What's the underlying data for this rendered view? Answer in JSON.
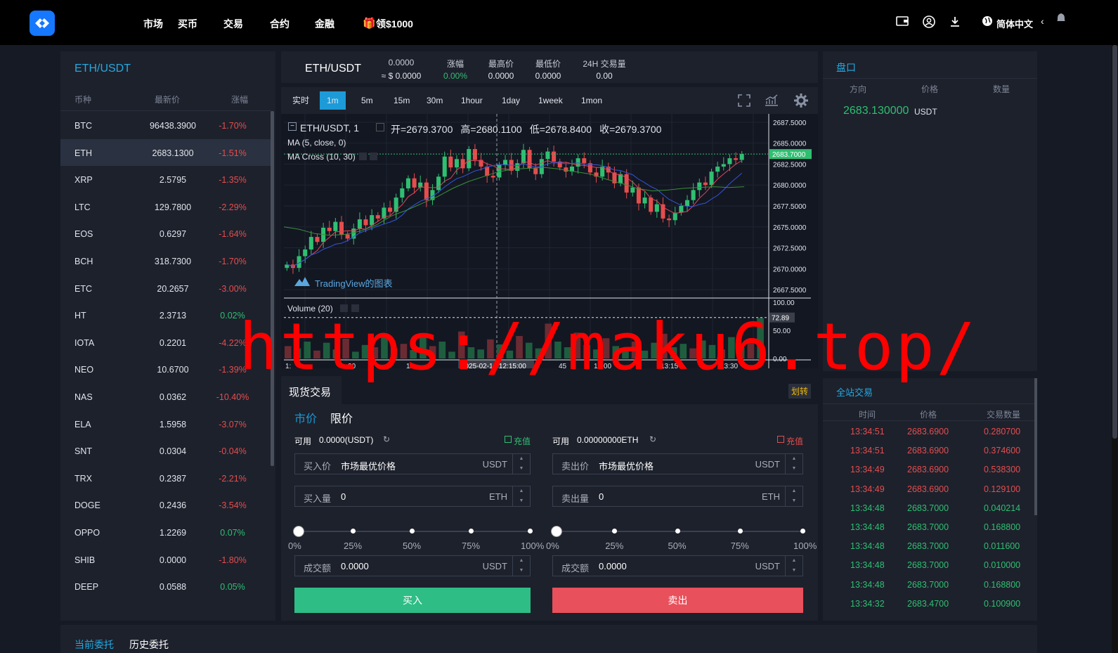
{
  "nav": {
    "items": [
      "市场",
      "买币",
      "交易",
      "合约",
      "金融"
    ],
    "promo": "领$1000",
    "lang": "简体中文"
  },
  "market": {
    "title": "ETH/USDT",
    "headers": [
      "币种",
      "最新价",
      "涨幅"
    ],
    "rows": [
      {
        "sym": "BTC",
        "price": "96438.3900",
        "chg": "-1.70%",
        "dir": "down"
      },
      {
        "sym": "ETH",
        "price": "2683.1300",
        "chg": "-1.51%",
        "dir": "down"
      },
      {
        "sym": "XRP",
        "price": "2.5795",
        "chg": "-1.35%",
        "dir": "down"
      },
      {
        "sym": "LTC",
        "price": "129.7800",
        "chg": "-2.29%",
        "dir": "down"
      },
      {
        "sym": "EOS",
        "price": "0.6297",
        "chg": "-1.64%",
        "dir": "down"
      },
      {
        "sym": "BCH",
        "price": "318.7300",
        "chg": "-1.70%",
        "dir": "down"
      },
      {
        "sym": "ETC",
        "price": "20.2657",
        "chg": "-3.00%",
        "dir": "down"
      },
      {
        "sym": "HT",
        "price": "2.3713",
        "chg": "0.02%",
        "dir": "up"
      },
      {
        "sym": "IOTA",
        "price": "0.2201",
        "chg": "-4.22%",
        "dir": "down"
      },
      {
        "sym": "NEO",
        "price": "10.6700",
        "chg": "-1.39%",
        "dir": "down"
      },
      {
        "sym": "NAS",
        "price": "0.0362",
        "chg": "-10.40%",
        "dir": "down"
      },
      {
        "sym": "ELA",
        "price": "1.5958",
        "chg": "-3.07%",
        "dir": "down"
      },
      {
        "sym": "SNT",
        "price": "0.0304",
        "chg": "-0.04%",
        "dir": "down"
      },
      {
        "sym": "TRX",
        "price": "0.2387",
        "chg": "-2.21%",
        "dir": "down"
      },
      {
        "sym": "DOGE",
        "price": "0.2436",
        "chg": "-3.54%",
        "dir": "down"
      },
      {
        "sym": "OPPO",
        "price": "1.2269",
        "chg": "0.07%",
        "dir": "up"
      },
      {
        "sym": "SHIB",
        "price": "0.0000",
        "chg": "-1.80%",
        "dir": "down"
      },
      {
        "sym": "DEEP",
        "price": "0.0588",
        "chg": "0.05%",
        "dir": "up"
      }
    ]
  },
  "ticker": {
    "symbol": "ETH/USDT",
    "price": "0.0000",
    "price_usd": "≈ $ 0.0000",
    "labels": [
      "涨幅",
      "最高价",
      "最低价",
      "24H 交易量"
    ],
    "values": [
      "0.00%",
      "0.0000",
      "0.0000",
      "0.00"
    ]
  },
  "chart": {
    "timeframes": [
      "实时",
      "1m",
      "5m",
      "15m",
      "30m",
      "1hour",
      "1day",
      "1week",
      "1mon"
    ],
    "active_tf": "1m",
    "symbol_line": "ETH/USDT, 1",
    "ohlc": [
      {
        "k": "开=",
        "v": "2679.3700"
      },
      {
        "k": "高=",
        "v": "2680.1100"
      },
      {
        "k": "低=",
        "v": "2678.8400"
      },
      {
        "k": "收=",
        "v": "2679.3700"
      }
    ],
    "ma_label": "MA (5, close, 0)",
    "macross_label": "MA Cross (10, 30)",
    "tv_label": "TradingView的图表",
    "volume_label": "Volume (20)",
    "price_ticks": [
      "2687.5000",
      "2685.0000",
      "2682.5000",
      "2680.0000",
      "2677.5000",
      "2675.0000",
      "2672.5000",
      "2670.0000",
      "2667.5000"
    ],
    "last_price": "2683.7000",
    "vol_ticks": [
      "100.00",
      "50.00",
      "0.00"
    ],
    "vol_last": "72.89",
    "time_ticks": [
      "1:",
      "00",
      "12:",
      "45",
      "13:00",
      "13:15",
      "13:30"
    ],
    "crosshair_time": "2025-02-12 12:15:00"
  },
  "chart_data": {
    "type": "candlestick",
    "title": "ETH/USDT, 1",
    "ylim": [
      2666.5,
      2688.5
    ],
    "closes": [
      2670.5,
      2670.1,
      2671.5,
      2672.3,
      2673.8,
      2673.2,
      2674.9,
      2674.5,
      2675.6,
      2674.1,
      2673.6,
      2674.8,
      2675.9,
      2675.2,
      2676.4,
      2676.0,
      2677.3,
      2676.8,
      2678.5,
      2679.6,
      2680.8,
      2679.7,
      2680.3,
      2678.2,
      2679.4,
      2681.0,
      2683.4,
      2682.1,
      2683.1,
      2682.0,
      2684.3,
      2683.0,
      2682.2,
      2681.1,
      2680.9,
      2682.4,
      2683.0,
      2681.7,
      2682.6,
      2684.2,
      2682.0,
      2681.3,
      2683.1,
      2684.0,
      2682.8,
      2682.1,
      2681.6,
      2682.2,
      2683.2,
      2682.6,
      2681.5,
      2681.0,
      2682.2,
      2681.5,
      2680.2,
      2681.3,
      2679.1,
      2679.7,
      2677.8,
      2678.5,
      2676.8,
      2677.7,
      2676.0,
      2675.8,
      2676.7,
      2677.5,
      2678.2,
      2679.4,
      2680.3,
      2680.0,
      2681.6,
      2682.2,
      2682.5,
      2683.2,
      2683.0,
      2683.7
    ],
    "ma_cross_long": [
      2675.0,
      2674.7,
      2674.2,
      2674.0,
      2674.1,
      2674.5,
      2675.2,
      2676.3,
      2677.0,
      2677.8,
      2678.6,
      2679.6,
      2680.4,
      2681.0,
      2681.6,
      2681.9,
      2682.0,
      2682.1,
      2681.9,
      2681.6,
      2681.3,
      2680.7,
      2680.2,
      2679.6,
      2679.3,
      2679.4,
      2679.6,
      2679.7,
      2679.8,
      2679.7,
      2679.8
    ],
    "volume": [
      22,
      18,
      30,
      14,
      28,
      16,
      35,
      12,
      24,
      20,
      44,
      18,
      26,
      15,
      38,
      22,
      30,
      12,
      48,
      20,
      16,
      34,
      25,
      14,
      40,
      28,
      18,
      62,
      30,
      20,
      46,
      24,
      16,
      36,
      22,
      18,
      30,
      14,
      28,
      44,
      20,
      26,
      18,
      32,
      24,
      16,
      38,
      20,
      30,
      72
    ]
  },
  "spot": {
    "title": "现货交易",
    "transfer": "划转",
    "tab_market": "市价",
    "tab_limit": "限价",
    "buy": {
      "avail_label": "可用",
      "avail_value": "0.0000(USDT)",
      "recharge": "充值",
      "price_label": "买入价",
      "price_value": "市场最优价格",
      "price_unit": "USDT",
      "qty_label": "买入量",
      "qty_value": "0",
      "qty_unit": "ETH",
      "amount_label": "成交额",
      "amount_value": "0.0000",
      "amount_unit": "USDT",
      "button": "买入"
    },
    "sell": {
      "avail_label": "可用",
      "avail_value": "0.00000000ETH",
      "recharge": "充值",
      "price_label": "卖出价",
      "price_value": "市场最优价格",
      "price_unit": "USDT",
      "qty_label": "卖出量",
      "qty_value": "0",
      "qty_unit": "ETH",
      "amount_label": "成交额",
      "amount_value": "0.0000",
      "amount_unit": "USDT",
      "button": "卖出"
    },
    "pcts": [
      "0%",
      "25%",
      "50%",
      "75%",
      "100%"
    ],
    "slider_value": 0
  },
  "book": {
    "title": "盘口",
    "headers": [
      "方向",
      "价格",
      "数量"
    ],
    "last_price": "2683.130000",
    "last_unit": "USDT"
  },
  "trades": {
    "title": "全站交易",
    "headers": [
      "时间",
      "价格",
      "交易数量"
    ],
    "rows": [
      {
        "t": "13:34:51",
        "p": "2683.6900",
        "q": "0.280700",
        "dir": "down"
      },
      {
        "t": "13:34:51",
        "p": "2683.6900",
        "q": "0.374600",
        "dir": "down"
      },
      {
        "t": "13:34:49",
        "p": "2683.6900",
        "q": "0.538300",
        "dir": "down"
      },
      {
        "t": "13:34:49",
        "p": "2683.6900",
        "q": "0.129100",
        "dir": "down"
      },
      {
        "t": "13:34:48",
        "p": "2683.7000",
        "q": "0.040214",
        "dir": "up"
      },
      {
        "t": "13:34:48",
        "p": "2683.7000",
        "q": "0.168800",
        "dir": "up"
      },
      {
        "t": "13:34:48",
        "p": "2683.7000",
        "q": "0.011600",
        "dir": "up"
      },
      {
        "t": "13:34:48",
        "p": "2683.7000",
        "q": "0.010000",
        "dir": "up"
      },
      {
        "t": "13:34:48",
        "p": "2683.7000",
        "q": "0.168800",
        "dir": "up"
      },
      {
        "t": "13:34:32",
        "p": "2683.4700",
        "q": "0.100900",
        "dir": "up"
      }
    ]
  },
  "bottom": {
    "tabs": [
      "当前委托",
      "历史委托"
    ]
  },
  "watermark": "https://maku6.top/",
  "colors": {
    "up": "#2fbf71",
    "down": "#e54d4d",
    "accent": "#1d9bd8",
    "buy": "#2ebd85",
    "sell": "#e8505b"
  }
}
